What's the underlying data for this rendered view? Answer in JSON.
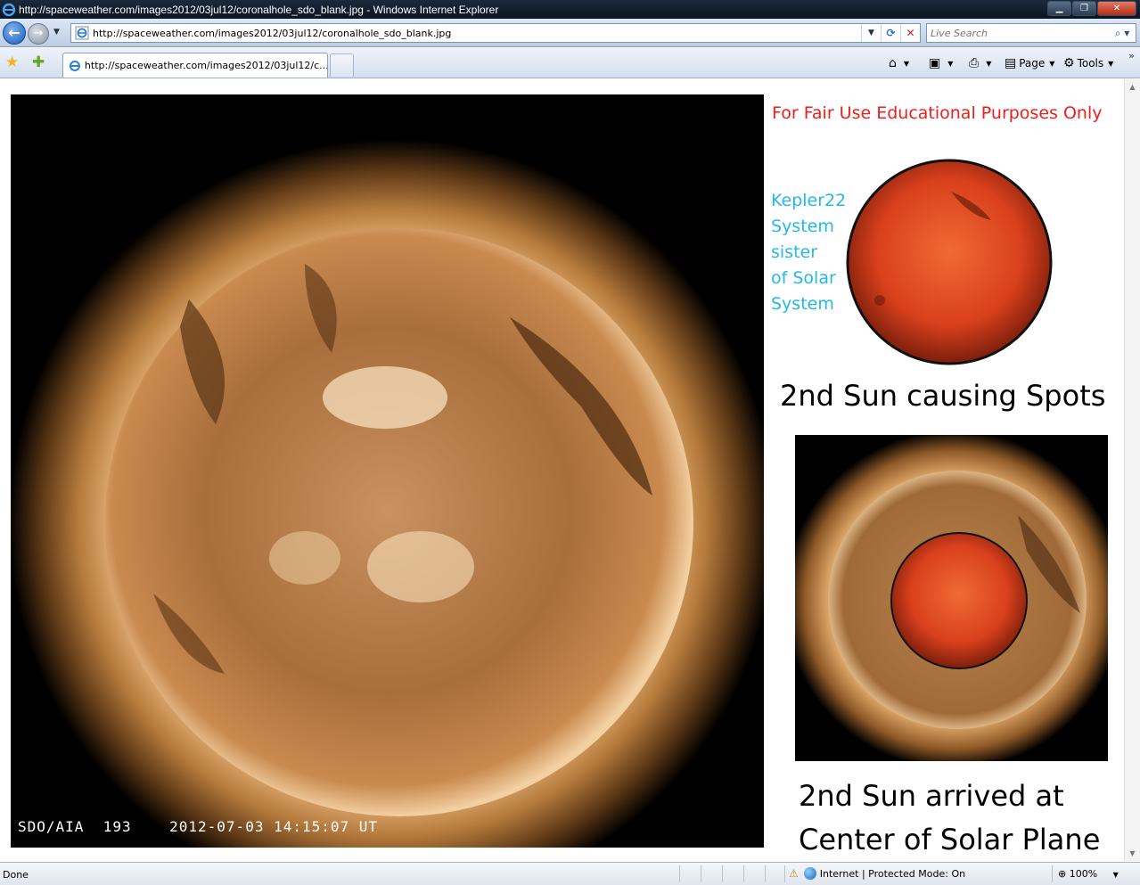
{
  "window": {
    "title": "http://spaceweather.com/images2012/03jul12/coronalhole_sdo_blank.jpg - Windows Internet Explorer",
    "minimize_icon": "minimize-icon",
    "maximize_icon": "maximize-icon",
    "close_icon": "close-icon"
  },
  "navigation": {
    "address": "http://spaceweather.com/images2012/03jul12/coronalhole_sdo_blank.jpg",
    "search_placeholder": "Live Search"
  },
  "tabs": [
    {
      "label": "http://spaceweather.com/images2012/03jul12/c..."
    }
  ],
  "command_bar": {
    "home_icon": "home-icon",
    "feeds_icon": "feeds-icon",
    "print_icon": "print-icon",
    "page_label": "Page",
    "tools_label": "Tools"
  },
  "content": {
    "image_caption": "SDO/AIA  193    2012-07-03 14:15:07 UT",
    "notice": "For Fair Use Educational Purposes Only",
    "kepler_lines": [
      "Kepler22",
      "System",
      "sister",
      "of Solar",
      "System"
    ],
    "caption_spots": "2nd Sun causing Spots",
    "caption_arrived_line1": "2nd Sun arrived at",
    "caption_arrived_line2": "Center of Solar Plane"
  },
  "status": {
    "text": "Done",
    "zone": "Internet | Protected Mode: On",
    "zoom": "100%"
  },
  "colors": {
    "notice": "#f01d1d",
    "kepler_text": "#25b9e6",
    "sun_corona": "#b57a3c",
    "red_sun": "#d9401c"
  }
}
